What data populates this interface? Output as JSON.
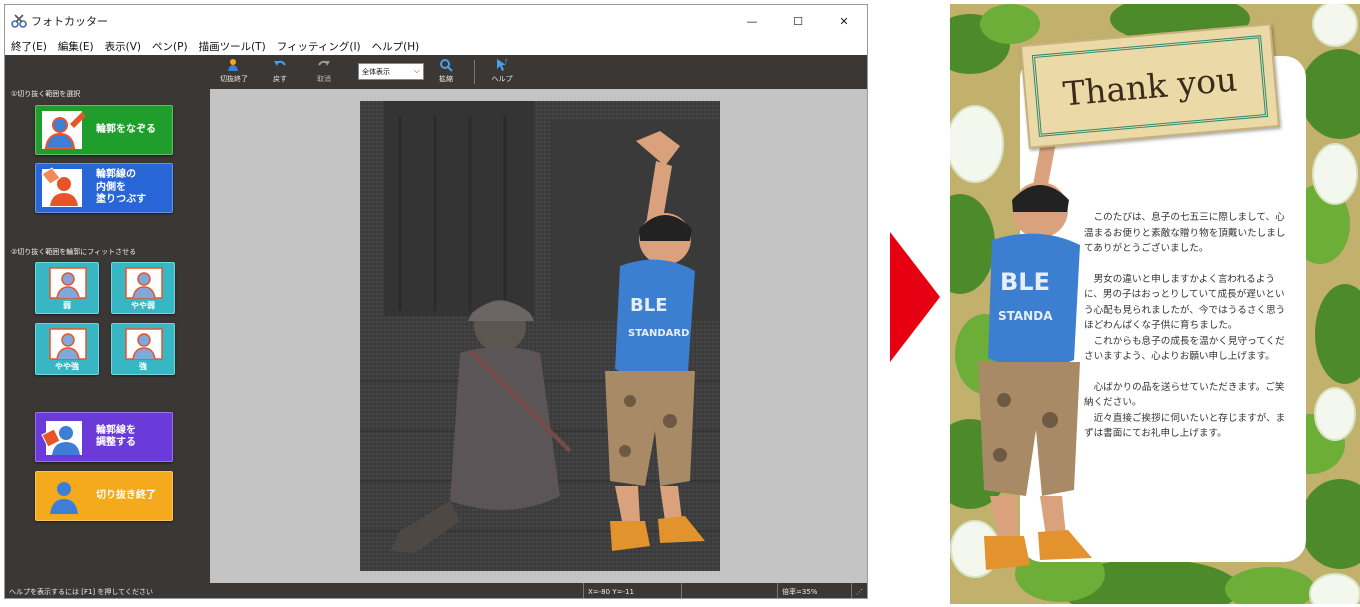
{
  "app": {
    "title": "フォトカッター",
    "controls": {
      "minimize": "—",
      "maximize": "☐",
      "close": "✕"
    }
  },
  "menu": [
    "終了(E)",
    "編集(E)",
    "表示(V)",
    "ペン(P)",
    "描画ツール(T)",
    "フィッティング(I)",
    "ヘルプ(H)"
  ],
  "toolbar": {
    "finish": "切抜終了",
    "undo": "戻す",
    "cancel": "取消",
    "view_select": "全体表示",
    "zoom": "拡縮",
    "help": "ヘルプ"
  },
  "left_panel": {
    "section1": "①切り抜く範囲を選択",
    "trace_outline": "輪郭をなぞる",
    "fill_inside": "輪郭線の\n内側を\n塗りつぶす",
    "section2": "②切り抜く範囲を輪郭にフィットさせる",
    "fit_weak": "弱",
    "fit_slightly_weak": "やや弱",
    "fit_slightly_strong": "やや強",
    "fit_strong": "強",
    "adjust_outline": "輪郭線を\n調整する",
    "finish_cut": "切り抜き終了"
  },
  "status": {
    "help_hint": "ヘルプを表示するには [F1] を押してください",
    "coords": "X=-80 Y=-11",
    "zoom": "倍率=35%"
  },
  "card": {
    "title": "Thank you",
    "para1": "　このたびは、息子の七五三に際しまして、心温まるお便りと素敵な贈り物を頂戴いたしましてありがとうございました。",
    "para2": "　男女の違いと申しますかよく言われるように、男の子はおっとりしていて成長が遅いという心配も見られましたが、今ではうるさく思うほどわんぱくな子供に育ちました。",
    "para3": "　これからも息子の成長を温かく見守ってくださいますよう、心よりお願い申し上げます。",
    "para4": "　心ばかりの品を送らせていただきます。ご笑納ください。",
    "para5": "　近々直接ご挨拶に伺いたいと存じますが、まずは書面にてお礼申し上げます。"
  },
  "colors": {
    "panel_bg": "#3b3734",
    "trace_green": "#1f9e2c",
    "fill_blue": "#2866d8",
    "fit_teal": "#37b7c4",
    "adjust_purple": "#6a3bd8",
    "finish_orange": "#f4aa1c",
    "arrow_red": "#e60012"
  }
}
